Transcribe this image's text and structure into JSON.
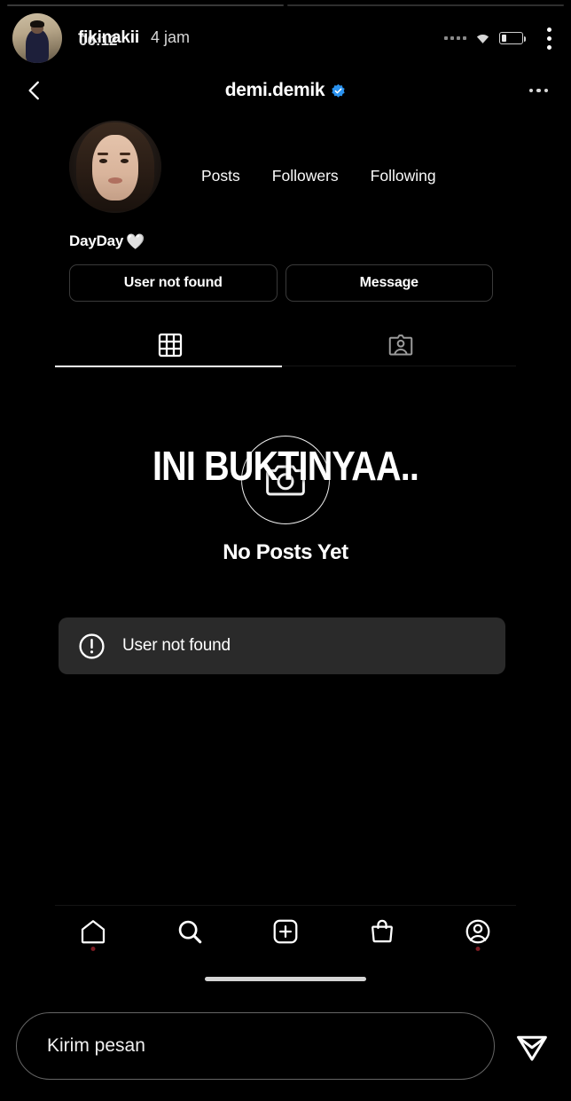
{
  "story": {
    "progress_segments": 2,
    "author_username": "fikinakii",
    "time_ago": "4 jam",
    "bleed_clock": "06:12",
    "avatar_name": "story-author-avatar",
    "overlay_text": "INI BUKTINYAA..",
    "more_icon": "kebab-menu-icon"
  },
  "status_bar": {
    "signal_icon": "signal-dots-icon",
    "wifi_icon": "wifi-icon",
    "battery_icon": "battery-low-icon",
    "battery_level_percent": 25
  },
  "profile": {
    "nav": {
      "back_icon": "back-chevron-icon",
      "username": "demi.demik",
      "verified_icon": "verified-badge-icon",
      "more_icon": "more-options-icon"
    },
    "avatar_name": "profile-picture",
    "stats": [
      {
        "label": "Posts",
        "value": ""
      },
      {
        "label": "Followers",
        "value": ""
      },
      {
        "label": "Following",
        "value": ""
      }
    ],
    "display_name": "DayDay",
    "display_name_emoji": "🤍",
    "actions": [
      {
        "label": "User not found",
        "name": "follow-button"
      },
      {
        "label": "Message",
        "name": "message-button"
      }
    ],
    "tabs": [
      {
        "name": "tab-grid",
        "icon": "grid-icon",
        "active": true
      },
      {
        "name": "tab-tagged",
        "icon": "tagged-person-icon",
        "active": false
      }
    ],
    "empty_state": {
      "icon": "camera-circle-icon",
      "title": "No Posts Yet"
    }
  },
  "bottom_nav": [
    {
      "name": "nav-home",
      "icon": "home-icon",
      "badge": true
    },
    {
      "name": "nav-search",
      "icon": "search-icon",
      "badge": false
    },
    {
      "name": "nav-create",
      "icon": "plus-square-icon",
      "badge": false
    },
    {
      "name": "nav-shop",
      "icon": "shopping-bag-icon",
      "badge": false
    },
    {
      "name": "nav-profile",
      "icon": "profile-circle-icon",
      "badge": true
    }
  ],
  "toast": {
    "icon": "exclamation-circle-icon",
    "message": "User not found"
  },
  "reply": {
    "placeholder": "Kirim pesan",
    "value": "",
    "send_icon": "paper-plane-icon"
  },
  "colors": {
    "background": "#000000",
    "verified_blue": "#2b93f0",
    "toast_bg": "#2a2a2a",
    "badge_red": "#7a1b22",
    "text_primary": "#ffffff",
    "border_subtle": "#3a3a3a"
  }
}
